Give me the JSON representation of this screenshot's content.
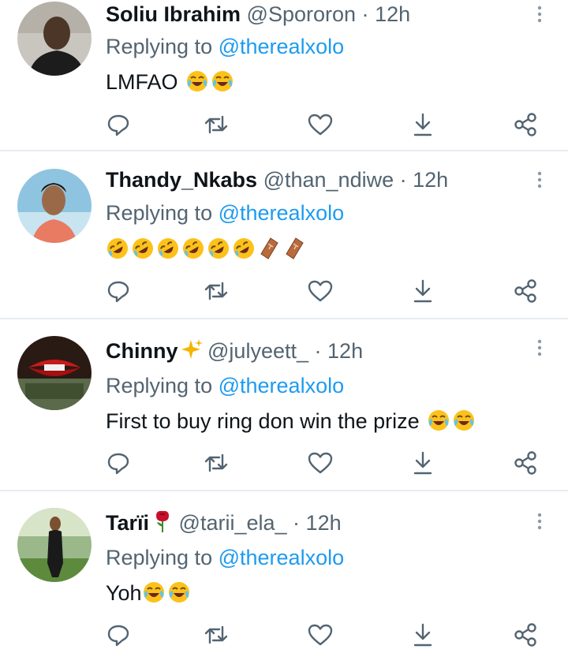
{
  "tweets": [
    {
      "name": "Soliu Ibrahim",
      "handle": "@Spororon",
      "separator": "·",
      "time": "12h",
      "reply_prefix": "Replying to",
      "reply_to": "@therealxolo",
      "text": "LMFAO",
      "emojis": [
        "face-with-tears-of-joy-icon",
        "face-with-tears-of-joy-icon"
      ],
      "avatar_color": "#8a7560"
    },
    {
      "name": "Thandy_Nkabs",
      "handle": "@than_ndiwe",
      "separator": "·",
      "time": "12h",
      "reply_prefix": "Replying to",
      "reply_to": "@therealxolo",
      "text": "",
      "emojis": [
        "rolling-on-floor-laughing-icon",
        "rolling-on-floor-laughing-icon",
        "rolling-on-floor-laughing-icon",
        "rolling-on-floor-laughing-icon",
        "rolling-on-floor-laughing-icon",
        "rolling-on-floor-laughing-icon",
        "coffin-icon",
        "coffin-icon"
      ],
      "avatar_color": "#7fb8d8"
    },
    {
      "name": "Chinny",
      "name_emoji": "sparkles-icon",
      "handle": "@julyeett_",
      "separator": "·",
      "time": "12h",
      "reply_prefix": "Replying to",
      "reply_to": "@therealxolo",
      "text": "First to buy ring don win the prize",
      "emojis": [
        "face-with-tears-of-joy-icon",
        "face-with-tears-of-joy-icon"
      ],
      "avatar_color": "#3a2a20"
    },
    {
      "name": "Tarïi",
      "name_emoji": "rose-icon",
      "handle": "@tarii_ela_",
      "separator": "·",
      "time": "12h",
      "reply_prefix": "Replying to",
      "reply_to": "@therealxolo",
      "text": "Yoh",
      "emojis": [
        "face-with-tears-of-joy-icon",
        "face-with-tears-of-joy-icon"
      ],
      "avatar_color": "#6e8a5a"
    }
  ],
  "actions": [
    "reply-icon",
    "retweet-icon",
    "like-icon",
    "share-icon",
    "share-network-icon"
  ],
  "colors": {
    "text": "#0f1419",
    "secondary": "#536471",
    "accent": "#1d9bf0",
    "divider": "#e6ecf0"
  }
}
